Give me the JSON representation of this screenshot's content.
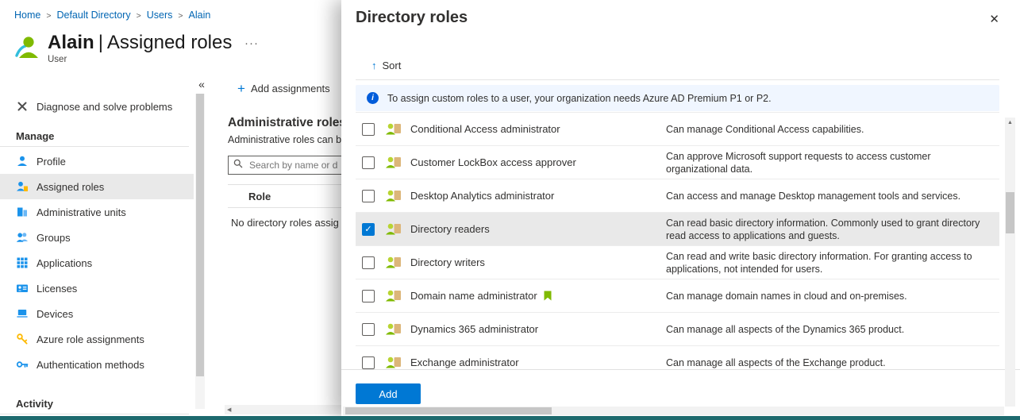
{
  "colors": {
    "accent": "#0078d4",
    "breadcrumb_link": "#0065b3",
    "info_banner_bg": "#f0f6ff",
    "selected_row_bg": "#e9e9e9",
    "role_person_green": "#7fba00",
    "bottom_edge": "#1d6a6e"
  },
  "breadcrumb": {
    "separator": ">",
    "items": [
      "Home",
      "Default Directory",
      "Users",
      "Alain"
    ]
  },
  "header": {
    "title_primary": "Alain",
    "title_separator": "|",
    "title_secondary": "Assigned roles",
    "subtitle": "User",
    "more_label": "···"
  },
  "sidebar": {
    "collapse_label": "«",
    "items": [
      {
        "type": "link",
        "label": "Diagnose and solve problems",
        "icon": "diagnose-icon"
      },
      {
        "type": "section",
        "label": "Manage"
      },
      {
        "type": "link",
        "label": "Profile",
        "icon": "profile-icon"
      },
      {
        "type": "link",
        "label": "Assigned roles",
        "icon": "assigned-roles-icon",
        "selected": true
      },
      {
        "type": "link",
        "label": "Administrative units",
        "icon": "administrative-units-icon"
      },
      {
        "type": "link",
        "label": "Groups",
        "icon": "groups-icon"
      },
      {
        "type": "link",
        "label": "Applications",
        "icon": "applications-icon"
      },
      {
        "type": "link",
        "label": "Licenses",
        "icon": "licenses-icon"
      },
      {
        "type": "link",
        "label": "Devices",
        "icon": "devices-icon"
      },
      {
        "type": "link",
        "label": "Azure role assignments",
        "icon": "azure-role-assignments-icon"
      },
      {
        "type": "link",
        "label": "Authentication methods",
        "icon": "authentication-methods-icon"
      },
      {
        "type": "section",
        "label": "Activity"
      }
    ]
  },
  "content": {
    "add_icon": "+",
    "add_assignments_label": "Add assignments",
    "heading": "Administrative roles",
    "description_visible": "Administrative roles can b",
    "search_placeholder": "Search by name or d",
    "column_role": "Role",
    "empty_text": "No directory roles assig"
  },
  "flyout": {
    "title": "Directory roles",
    "close_icon": "✕",
    "sort_icon": "↑",
    "sort_label": "Sort",
    "info_text": "To assign custom roles to a user, your organization needs Azure AD Premium P1 or P2.",
    "add_button": "Add",
    "roles": [
      {
        "name": "Conditional Access administrator",
        "description": "Can manage Conditional Access capabilities.",
        "checked": false
      },
      {
        "name": "Customer LockBox access approver",
        "description": "Can approve Microsoft support requests to access customer organizational data.",
        "checked": false
      },
      {
        "name": "Desktop Analytics administrator",
        "description": "Can access and manage Desktop management tools and services.",
        "checked": false
      },
      {
        "name": "Directory readers",
        "description": "Can read basic directory information. Commonly used to grant directory read access to applications and guests.",
        "checked": true
      },
      {
        "name": "Directory writers",
        "description": "Can read and write basic directory information. For granting access to applications, not intended for users.",
        "checked": false
      },
      {
        "name": "Domain name administrator",
        "description": "Can manage domain names in cloud and on-premises.",
        "checked": false,
        "badge": "bookmark"
      },
      {
        "name": "Dynamics 365 administrator",
        "description": "Can manage all aspects of the Dynamics 365 product.",
        "checked": false
      },
      {
        "name": "Exchange administrator",
        "description": "Can manage all aspects of the Exchange product.",
        "checked": false
      }
    ]
  },
  "scrollbars": {
    "up_arrow": "▲",
    "left_arrow": "◀"
  }
}
